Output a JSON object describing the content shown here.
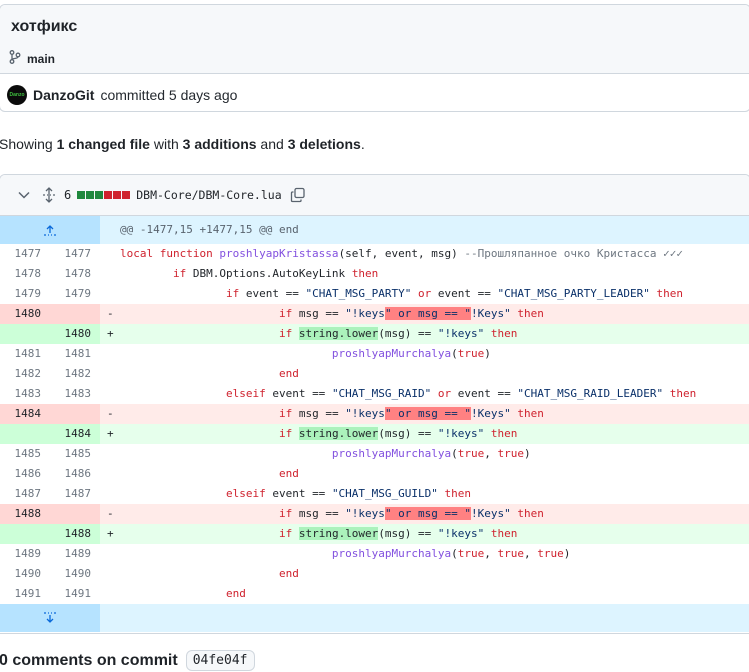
{
  "commit": {
    "title": "хотфикс",
    "branch": "main",
    "author": "DanzoGit",
    "avatar_text": "Danzo",
    "committed_text": "committed 5 days ago"
  },
  "summary": {
    "prefix": "Showing ",
    "files": "1 changed file",
    "with": " with ",
    "additions": "3 additions",
    "and": " and ",
    "deletions": "3 deletions",
    "end": "."
  },
  "file": {
    "change_count": "6",
    "path": "DBM-Core/DBM-Core.lua",
    "diffstat_colors": [
      "#1f883d",
      "#1f883d",
      "#1f883d",
      "#cf222e",
      "#cf222e",
      "#cf222e"
    ]
  },
  "hunk": {
    "header": "@@ -1477,15 +1477,15 @@ end"
  },
  "lines": [
    {
      "type": "ctx",
      "old": "1477",
      "new": "1477",
      "parts": [
        [
          "kw",
          "local function "
        ],
        [
          "fn",
          "proshlyapKristassa"
        ],
        [
          "",
          "(self, event, msg) "
        ],
        [
          "cm",
          "--Прошляпанное очко Кристасса ✓✓✓"
        ]
      ]
    },
    {
      "type": "ctx",
      "old": "1478",
      "new": "1478",
      "parts": [
        [
          "",
          "        "
        ],
        [
          "kw",
          "if "
        ],
        [
          "",
          "DBM.Options.AutoKeyLink "
        ],
        [
          "kw",
          "then"
        ]
      ]
    },
    {
      "type": "ctx",
      "old": "1479",
      "new": "1479",
      "parts": [
        [
          "",
          "                "
        ],
        [
          "kw",
          "if "
        ],
        [
          "",
          "event == "
        ],
        [
          "str",
          "\"CHAT_MSG_PARTY\""
        ],
        [
          "kw",
          " or "
        ],
        [
          "",
          "event == "
        ],
        [
          "str",
          "\"CHAT_MSG_PARTY_LEADER\""
        ],
        [
          "kw",
          " then"
        ]
      ]
    },
    {
      "type": "del",
      "old": "1480",
      "new": "",
      "parts": [
        [
          "",
          "                        "
        ],
        [
          "kw",
          "if "
        ],
        [
          "",
          "msg == "
        ],
        [
          "str",
          "\"!keys"
        ],
        [
          "hl-del str",
          "\" or msg == \""
        ],
        [
          "str",
          "!Keys\""
        ],
        [
          "kw",
          " then"
        ]
      ]
    },
    {
      "type": "add",
      "old": "",
      "new": "1480",
      "parts": [
        [
          "",
          "                        "
        ],
        [
          "kw",
          "if "
        ],
        [
          "hl-add",
          "string.lower"
        ],
        [
          "",
          "(msg) == "
        ],
        [
          "str",
          "\"!keys\""
        ],
        [
          "kw",
          " then"
        ]
      ]
    },
    {
      "type": "ctx",
      "old": "1481",
      "new": "1481",
      "parts": [
        [
          "",
          "                                "
        ],
        [
          "fn",
          "proshlyapMurchalya"
        ],
        [
          "",
          "("
        ],
        [
          "kw",
          "true"
        ],
        [
          "",
          ")"
        ]
      ]
    },
    {
      "type": "ctx",
      "old": "1482",
      "new": "1482",
      "parts": [
        [
          "",
          "                        "
        ],
        [
          "kw",
          "end"
        ]
      ]
    },
    {
      "type": "ctx",
      "old": "1483",
      "new": "1483",
      "parts": [
        [
          "",
          "                "
        ],
        [
          "kw",
          "elseif "
        ],
        [
          "",
          "event == "
        ],
        [
          "str",
          "\"CHAT_MSG_RAID\""
        ],
        [
          "kw",
          " or "
        ],
        [
          "",
          "event == "
        ],
        [
          "str",
          "\"CHAT_MSG_RAID_LEADER\""
        ],
        [
          "kw",
          " then"
        ]
      ]
    },
    {
      "type": "del",
      "old": "1484",
      "new": "",
      "parts": [
        [
          "",
          "                        "
        ],
        [
          "kw",
          "if "
        ],
        [
          "",
          "msg == "
        ],
        [
          "str",
          "\"!keys"
        ],
        [
          "hl-del str",
          "\" or msg == \""
        ],
        [
          "str",
          "!Keys\""
        ],
        [
          "kw",
          " then"
        ]
      ]
    },
    {
      "type": "add",
      "old": "",
      "new": "1484",
      "parts": [
        [
          "",
          "                        "
        ],
        [
          "kw",
          "if "
        ],
        [
          "hl-add",
          "string.lower"
        ],
        [
          "",
          "(msg) == "
        ],
        [
          "str",
          "\"!keys\""
        ],
        [
          "kw",
          " then"
        ]
      ]
    },
    {
      "type": "ctx",
      "old": "1485",
      "new": "1485",
      "parts": [
        [
          "",
          "                                "
        ],
        [
          "fn",
          "proshlyapMurchalya"
        ],
        [
          "",
          "("
        ],
        [
          "kw",
          "true"
        ],
        [
          "",
          ", "
        ],
        [
          "kw",
          "true"
        ],
        [
          "",
          ")"
        ]
      ]
    },
    {
      "type": "ctx",
      "old": "1486",
      "new": "1486",
      "parts": [
        [
          "",
          "                        "
        ],
        [
          "kw",
          "end"
        ]
      ]
    },
    {
      "type": "ctx",
      "old": "1487",
      "new": "1487",
      "parts": [
        [
          "",
          "                "
        ],
        [
          "kw",
          "elseif "
        ],
        [
          "",
          "event == "
        ],
        [
          "str",
          "\"CHAT_MSG_GUILD\""
        ],
        [
          "kw",
          " then"
        ]
      ]
    },
    {
      "type": "del",
      "old": "1488",
      "new": "",
      "parts": [
        [
          "",
          "                        "
        ],
        [
          "kw",
          "if "
        ],
        [
          "",
          "msg == "
        ],
        [
          "str",
          "\"!keys"
        ],
        [
          "hl-del str",
          "\" or msg == \""
        ],
        [
          "str",
          "!Keys\""
        ],
        [
          "kw",
          " then"
        ]
      ]
    },
    {
      "type": "add",
      "old": "",
      "new": "1488",
      "parts": [
        [
          "",
          "                        "
        ],
        [
          "kw",
          "if "
        ],
        [
          "hl-add",
          "string.lower"
        ],
        [
          "",
          "(msg) == "
        ],
        [
          "str",
          "\"!keys\""
        ],
        [
          "kw",
          " then"
        ]
      ]
    },
    {
      "type": "ctx",
      "old": "1489",
      "new": "1489",
      "parts": [
        [
          "",
          "                                "
        ],
        [
          "fn",
          "proshlyapMurchalya"
        ],
        [
          "",
          "("
        ],
        [
          "kw",
          "true"
        ],
        [
          "",
          ", "
        ],
        [
          "kw",
          "true"
        ],
        [
          "",
          ", "
        ],
        [
          "kw",
          "true"
        ],
        [
          "",
          ")"
        ]
      ]
    },
    {
      "type": "ctx",
      "old": "1490",
      "new": "1490",
      "parts": [
        [
          "",
          "                        "
        ],
        [
          "kw",
          "end"
        ]
      ]
    },
    {
      "type": "ctx",
      "old": "1491",
      "new": "1491",
      "parts": [
        [
          "",
          "                "
        ],
        [
          "kw",
          "end"
        ]
      ]
    }
  ],
  "comments": {
    "label": "0 comments on commit",
    "sha": "04fe04f"
  }
}
